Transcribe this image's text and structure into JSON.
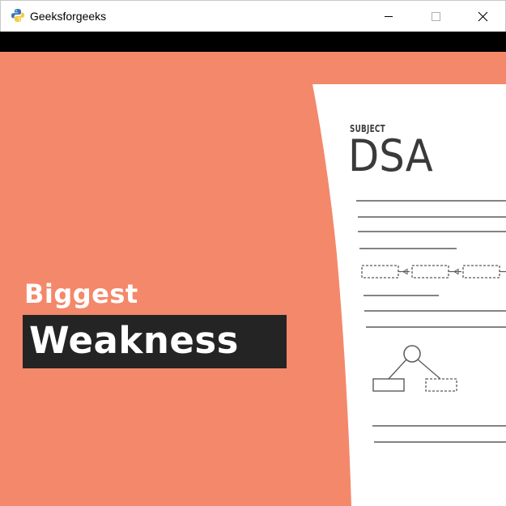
{
  "window": {
    "title": "Geeksforgeeks",
    "icon": "python-icon",
    "controls": [
      "minimize-icon",
      "maximize-icon",
      "close-icon"
    ]
  },
  "video_frame": {
    "headline_top": "Biggest",
    "headline_main": "Weakness",
    "document": {
      "subject_label": "SUBJECT",
      "subject_value": "DSA"
    }
  },
  "colors": {
    "background": "#f4886a",
    "headline_box": "#242424",
    "paper": "#ffffff",
    "ink": "#3a3a3a"
  }
}
